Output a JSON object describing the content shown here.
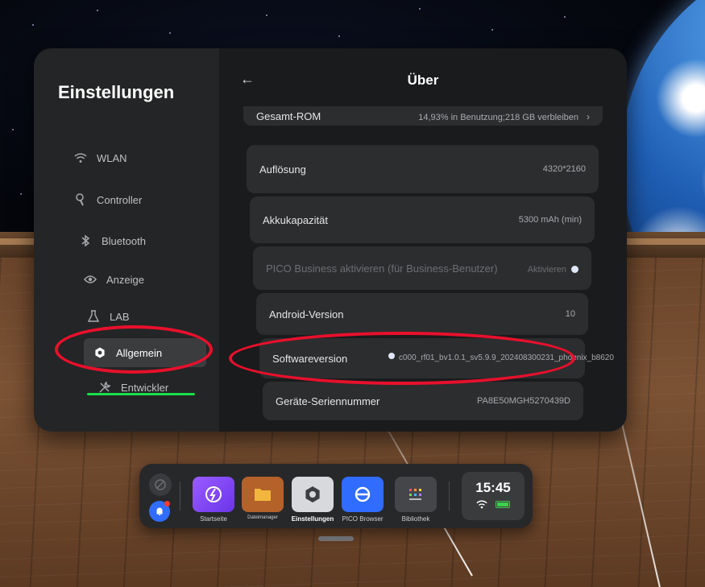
{
  "sidebar": {
    "title": "Einstellungen",
    "items": [
      {
        "label": "WLAN",
        "icon": "wifi-icon"
      },
      {
        "label": "Controller",
        "icon": "controller-icon"
      },
      {
        "label": "Bluetooth",
        "icon": "bluetooth-icon"
      },
      {
        "label": "Anzeige",
        "icon": "eye-icon"
      },
      {
        "label": "LAB",
        "icon": "flask-icon"
      },
      {
        "label": "Allgemein",
        "icon": "gear-icon",
        "active": true
      },
      {
        "label": "Entwickler",
        "icon": "tools-icon"
      }
    ]
  },
  "header": {
    "back_glyph": "←",
    "title": "Über"
  },
  "rows": [
    {
      "label": "Gesamt-ROM",
      "value": "14,93% in Benutzung;218 GB verbleiben",
      "chevron": "›"
    },
    {
      "label": "Auflösung",
      "value": "4320*2160"
    },
    {
      "label": "Akkukapazität",
      "value": "5300 mAh (min)"
    },
    {
      "label": "PICO Business aktivieren (für Business-Benutzer)",
      "value": "Aktivieren",
      "disabled": true
    },
    {
      "label": "Android-Version",
      "value": "10"
    },
    {
      "label": "Softwareversion",
      "value": "c000_rf01_bv1.0.1_sv5.9.9_202408300231_phoenix_b8620"
    },
    {
      "label": "Geräte-Seriennummer",
      "value": "PA8E50MGH5270439D"
    }
  ],
  "dock": {
    "apps": [
      {
        "label": "Startseite",
        "icon": "home-icon",
        "color": "#7b4cf0"
      },
      {
        "label": "Dateimanager",
        "icon": "folder-icon",
        "color": "#c96a2a"
      },
      {
        "label": "Einstellungen",
        "icon": "settings-icon",
        "color": "#d8d9dc",
        "active": true
      },
      {
        "label": "PICO Browser",
        "icon": "browser-icon",
        "color": "#2f6cff"
      },
      {
        "label": "Bibliothek",
        "icon": "library-icon",
        "color": "#4a4b4f"
      }
    ],
    "clock": "15:45"
  },
  "colors": {
    "annotation_red": "#e8102c",
    "annotation_green": "#17e04a",
    "battery_green": "#39d14e"
  }
}
